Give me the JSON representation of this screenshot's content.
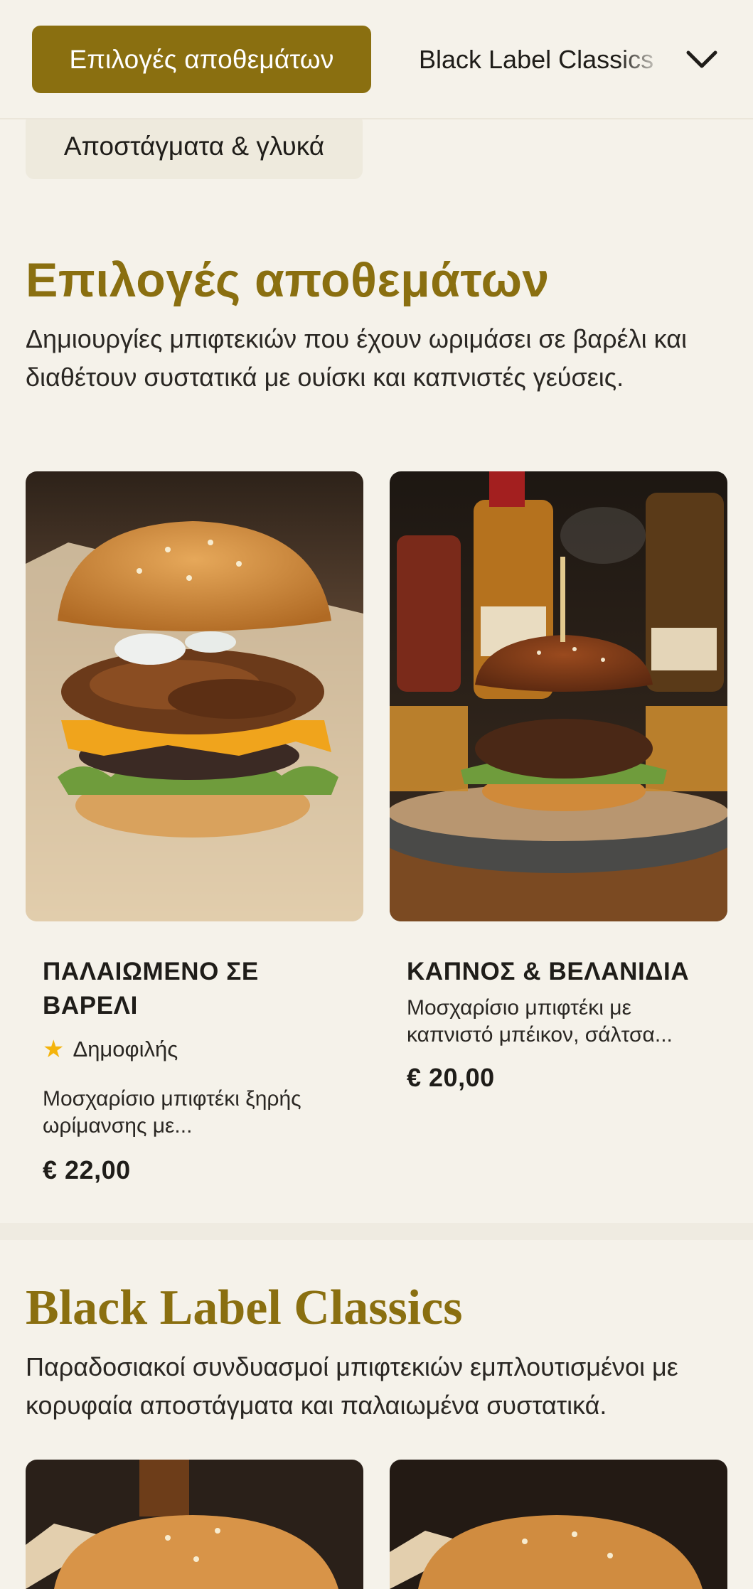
{
  "nav": {
    "active_label": "Επιλογές αποθεμάτων",
    "next_label": "Black Label Classics",
    "second_row_label": "Αποστάγματα & γλυκά"
  },
  "section1": {
    "title": "Επιλογές αποθεμάτων",
    "description": "Δημιουργίες μπιφτεκιών που έχουν ωριμάσει σε βαρέλι και διαθέτουν συστατικά με ουίσκι και καπνιστές γεύσεις.",
    "items": [
      {
        "name_line1": "ΠΑΛΑΙΩΜΕΝΟ ΣΕ",
        "name_line2": "ΒΑΡΕΛΙ",
        "badge": "Δημοφιλής",
        "desc_line1": "Μοσχαρίσιο μπιφτέκι ξηρής",
        "desc_line2": "ωρίμανσης με...",
        "price": "€ 22,00"
      },
      {
        "name": "ΚΑΠΝΟΣ & ΒΕΛΑΝΙΔΙΑ",
        "desc_line1": "Μοσχαρίσιο μπιφτέκι με",
        "desc_line2": "καπνιστό μπέικον, σάλτσα...",
        "price": "€ 20,00"
      }
    ]
  },
  "section2": {
    "title": "Black Label Classics",
    "description": "Παραδοσιακοί συνδυασμοί μπιφτεκιών εμπλουτισμένοι με κορυφαία αποστάγματα και παλαιωμένα συστατικά."
  },
  "colors": {
    "accent": "#8a6f10",
    "background": "#f5f2ea",
    "star": "#f4b40c"
  }
}
